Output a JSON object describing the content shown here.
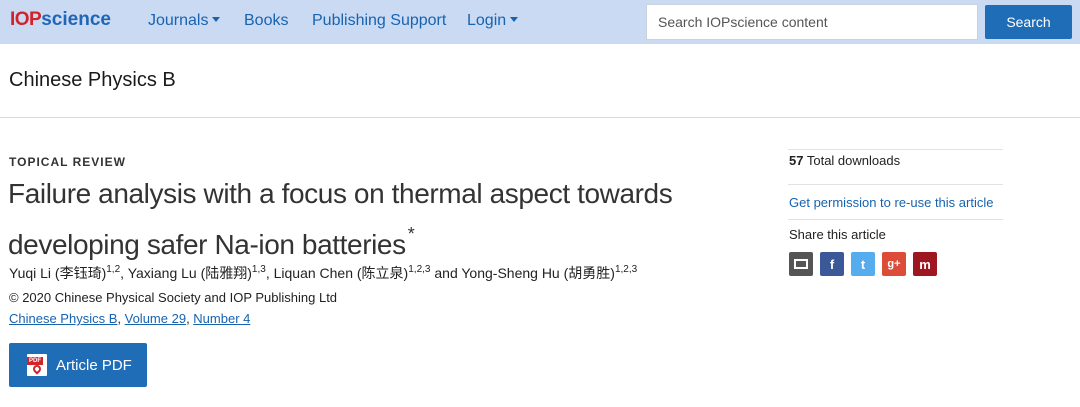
{
  "header": {
    "logo_iop": "IOP",
    "logo_science": "science",
    "nav": {
      "journals": "Journals",
      "books": "Books",
      "publishing_support": "Publishing Support",
      "login": "Login"
    },
    "search": {
      "placeholder": "Search IOPscience content",
      "button": "Search"
    }
  },
  "journal": {
    "title": "Chinese Physics B"
  },
  "article": {
    "type": "TOPICAL REVIEW",
    "title_line1": "Failure analysis with a focus on thermal aspect towards",
    "title_line2": "developing safer Na-ion batteries",
    "title_mark": "*",
    "authors": [
      {
        "name": "Yuqi Li (李钰琦)",
        "affil": "1,2",
        "sep": ", "
      },
      {
        "name": "Yaxiang Lu (陆雅翔)",
        "affil": "1,3",
        "sep": ", "
      },
      {
        "name": "Liquan Chen (陈立泉)",
        "affil": "1,2,3",
        "sep": " and "
      },
      {
        "name": "Yong-Sheng Hu (胡勇胜)",
        "affil": "1,2,3",
        "sep": ""
      }
    ],
    "copyright": "© 2020 Chinese Physical Society and IOP Publishing Ltd",
    "citation": {
      "journal": "Chinese Physics B",
      "volume": "Volume 29",
      "number": "Number 4",
      "separator": ", "
    },
    "pdf_button": "Article PDF",
    "pdf_icon_tag": "PDF"
  },
  "sidebar": {
    "downloads_count": "57",
    "downloads_label": " Total downloads",
    "permission_link": "Get permission to re-use this article",
    "share_label": "Share this article",
    "share_icons": [
      {
        "name": "email",
        "glyph": "",
        "color": "#555555"
      },
      {
        "name": "facebook",
        "glyph": "f",
        "color": "#3b5998"
      },
      {
        "name": "twitter",
        "glyph": "t",
        "color": "#55acee"
      },
      {
        "name": "google-plus",
        "glyph": "g+",
        "color": "#dd4b39"
      },
      {
        "name": "mendeley",
        "glyph": "m",
        "color": "#9d1620"
      }
    ]
  },
  "colors": {
    "nav_bg": "#cbdaf3",
    "link": "#1763b0",
    "button": "#1f6db7",
    "logo_red": "#d2232a"
  }
}
